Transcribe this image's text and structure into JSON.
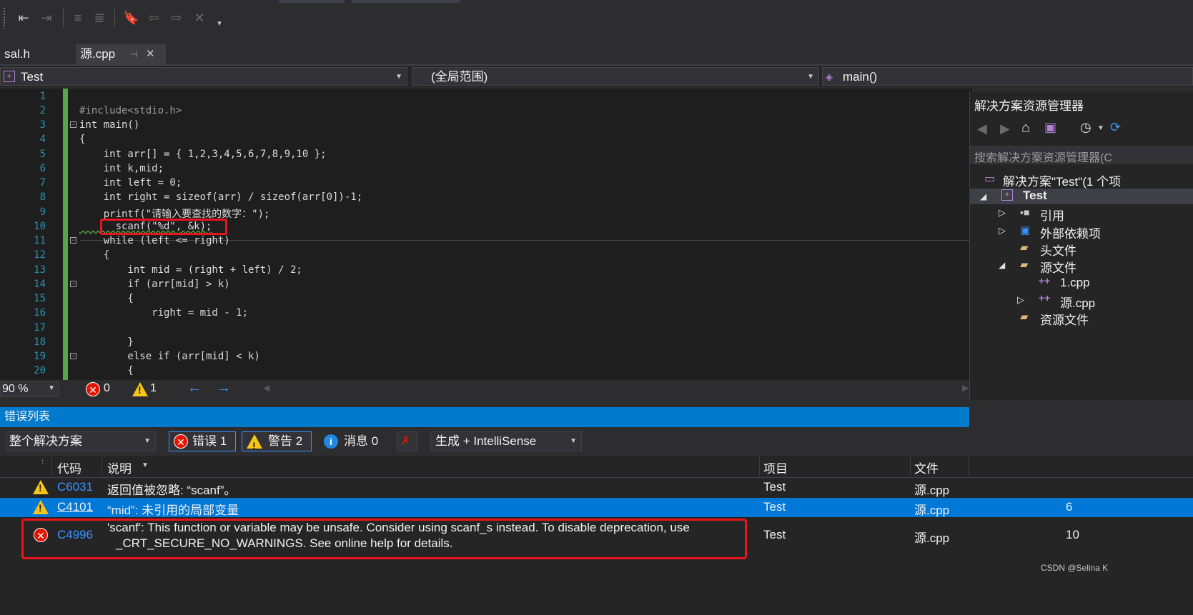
{
  "tabs": [
    {
      "label": "sal.h"
    },
    {
      "label": "源.cpp"
    }
  ],
  "navbar": {
    "project": "Test",
    "scope": "(全局范围)",
    "member": "main()"
  },
  "editor": {
    "line_numbers": [
      "1",
      "2",
      "3",
      "4",
      "5",
      "6",
      "7",
      "8",
      "9",
      "10",
      "11",
      "12",
      "13",
      "14",
      "15",
      "16",
      "17",
      "18",
      "19",
      "20"
    ],
    "lines": [
      "",
      "#include<stdio.h>",
      "int main()",
      "{",
      "    int arr[] = { 1,2,3,4,5,6,7,8,9,10 };",
      "    int k,mid;",
      "    int left = 0;",
      "    int right = sizeof(arr) / sizeof(arr[0])-1;",
      "    printf(\"请输入要查找的数字：\");",
      "      scanf(\"%d\", &k);",
      "    while (left <= right)",
      "    {",
      "        int mid = (right + left) / 2;",
      "        if (arr[mid] > k)",
      "        {",
      "            right = mid - 1;",
      "",
      "        }",
      "        else if (arr[mid] < k)",
      "        {"
    ]
  },
  "editor_status": {
    "zoom": "90 %",
    "errors": "0",
    "warnings": "1"
  },
  "solution_explorer": {
    "title": "解决方案资源管理器",
    "search_placeholder": "搜索解决方案资源管理器(C",
    "items": [
      {
        "label": "解决方案\"Test\"(1 个项"
      },
      {
        "label": "Test"
      },
      {
        "label": "引用"
      },
      {
        "label": "外部依赖项"
      },
      {
        "label": "头文件"
      },
      {
        "label": "源文件"
      },
      {
        "label": "1.cpp"
      },
      {
        "label": "源.cpp"
      },
      {
        "label": "资源文件"
      }
    ]
  },
  "error_list": {
    "title": "错误列表",
    "scope": "整个解决方案",
    "errors_label": "错误 1",
    "warnings_label": "警告 2",
    "messages_label": "消息 0",
    "build_filter": "生成 + IntelliSense",
    "columns": {
      "code": "代码",
      "description": "说明",
      "project": "项目",
      "file": "文件"
    },
    "rows": [
      {
        "severity": "warning",
        "code": "C6031",
        "description": "返回值被忽略: “scanf”。",
        "project": "Test",
        "file": "源.cpp",
        "line": ""
      },
      {
        "severity": "warning",
        "code": "C4101",
        "description": "“mid”: 未引用的局部变量",
        "project": "Test",
        "file": "源.cpp",
        "line": "6"
      },
      {
        "severity": "error",
        "code": "C4996",
        "description": "'scanf': This function or variable may be unsafe. Consider using scanf_s instead. To disable deprecation, use",
        "description2": "_CRT_SECURE_NO_WARNINGS. See online help for details.",
        "project": "Test",
        "file": "源.cpp",
        "line": "10"
      }
    ]
  },
  "watermark": "CSDN @Selina K",
  "colors": {
    "accent": "#007acc",
    "highlight_row": "#0078d7",
    "annotation": "#e8151f"
  }
}
